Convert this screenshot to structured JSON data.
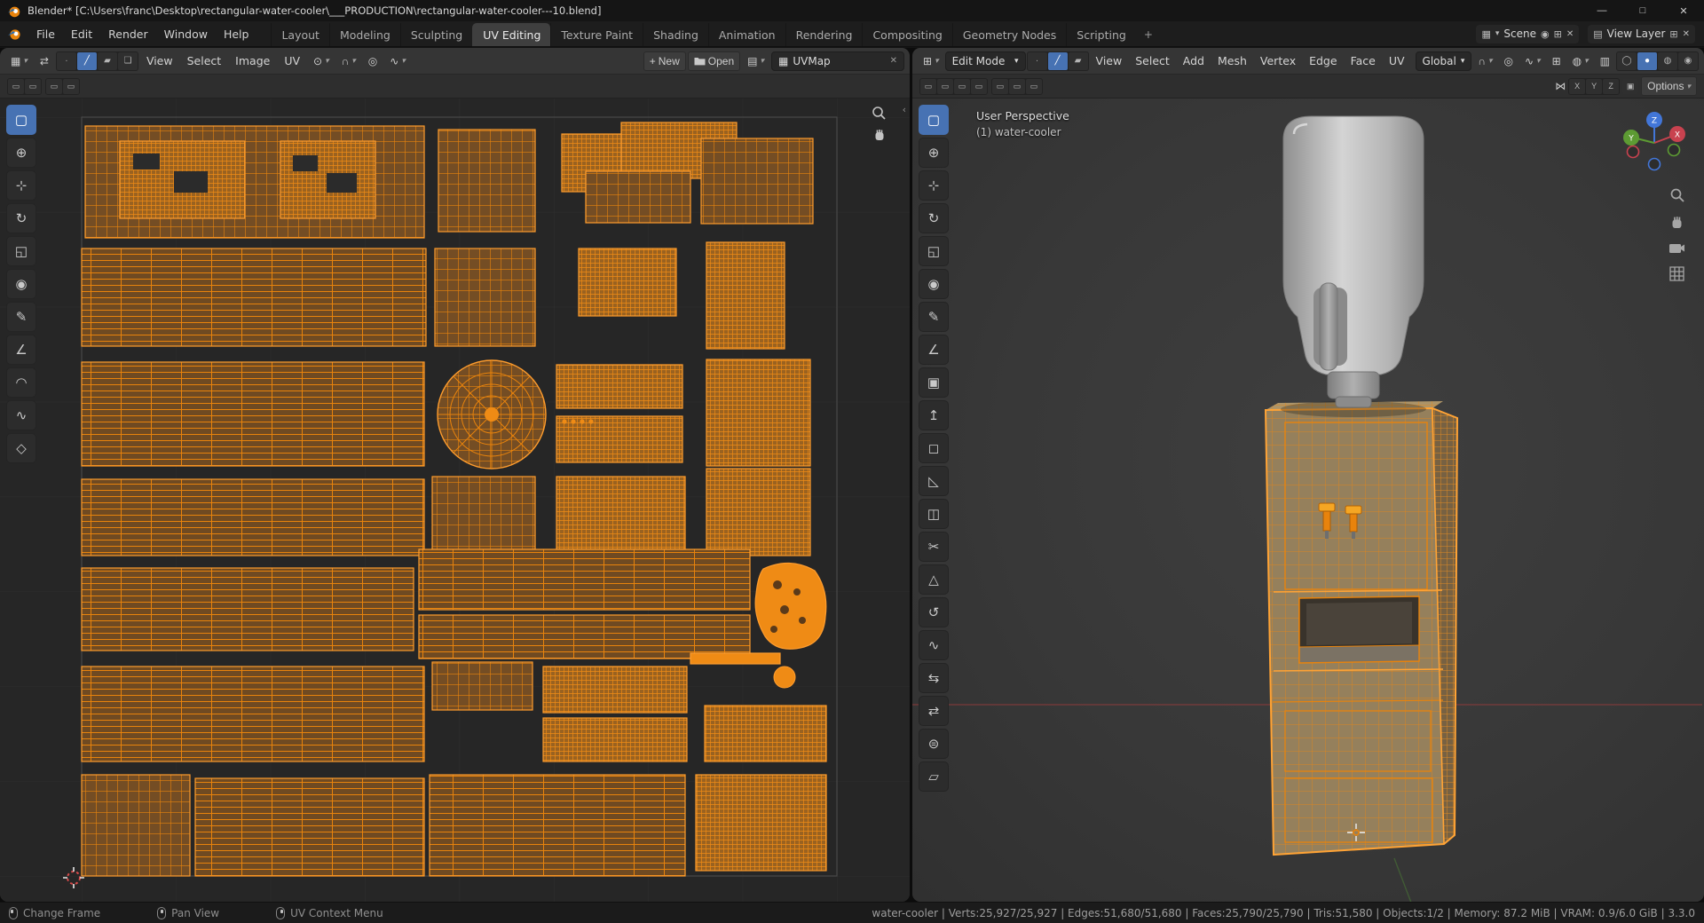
{
  "window": {
    "title": "Blender* [C:\\Users\\franc\\Desktop\\rectangular-water-cooler\\___PRODUCTION\\rectangular-water-cooler---10.blend]",
    "controls": {
      "minimize": "—",
      "maximize": "□",
      "close": "✕"
    }
  },
  "topbar": {
    "menus": [
      "File",
      "Edit",
      "Render",
      "Window",
      "Help"
    ],
    "workspaces": [
      "Layout",
      "Modeling",
      "Sculpting",
      "UV Editing",
      "Texture Paint",
      "Shading",
      "Animation",
      "Rendering",
      "Compositing",
      "Geometry Nodes",
      "Scripting"
    ],
    "add_tab": "+",
    "scene_label": "Scene",
    "view_layer_label": "View Layer"
  },
  "icons": {
    "chevron": "▾",
    "sync": "⇄",
    "magnet": "∩",
    "pivot": "⊙",
    "proportional": "◎",
    "falloff": "∿",
    "editor_uv": "▦",
    "editor_3d": "⊞",
    "image_browse": "▤",
    "scene": "▦",
    "view_layer": "▤",
    "pin": "◉",
    "copy": "⊞",
    "close_x": "✕",
    "plus": "+",
    "mirror": "⋈",
    "snap_target": "▣",
    "gizmo_toggle": "⊞",
    "overlays": "◍",
    "xray": "▥",
    "mode_vertex": "∙",
    "mode_edge": "╱",
    "mode_face": "▰",
    "mode_island": "❏",
    "shade_wire": "◯",
    "shade_solid": "●",
    "shade_material": "◍",
    "shade_render": "◉",
    "toggle": "▭",
    "collapse": "‹"
  },
  "uv_editor": {
    "menus": [
      "View",
      "Select",
      "Image",
      "UV"
    ],
    "new_button": "New",
    "open_button": "Open",
    "uv_map_name": "UVMap",
    "tools": [
      {
        "name": "select-box",
        "glyph": "▢"
      },
      {
        "name": "cursor",
        "glyph": "⊕"
      },
      {
        "name": "move",
        "glyph": "⊹"
      },
      {
        "name": "rotate",
        "glyph": "↻"
      },
      {
        "name": "scale",
        "glyph": "◱"
      },
      {
        "name": "transform",
        "glyph": "◉"
      },
      {
        "name": "annotate",
        "glyph": "✎"
      },
      {
        "name": "measure",
        "glyph": "∠"
      },
      {
        "name": "grab",
        "glyph": "◠"
      },
      {
        "name": "relax",
        "glyph": "∿"
      },
      {
        "name": "pinch",
        "glyph": "◇"
      }
    ]
  },
  "viewport": {
    "mode_selector": "Edit Mode",
    "menus": [
      "View",
      "Select",
      "Add",
      "Mesh",
      "Vertex",
      "Edge",
      "Face",
      "UV"
    ],
    "orientation": "Global",
    "options_label": "Options",
    "mirror_axes": [
      "X",
      "Y",
      "Z"
    ],
    "overlay": {
      "perspective": "User Perspective",
      "object": "(1) water-cooler"
    },
    "gizmo": {
      "x": "X",
      "y": "Y",
      "z": "Z"
    },
    "tools": [
      {
        "name": "select-box",
        "glyph": "▢"
      },
      {
        "name": "cursor",
        "glyph": "⊕"
      },
      {
        "name": "move",
        "glyph": "⊹"
      },
      {
        "name": "rotate",
        "glyph": "↻"
      },
      {
        "name": "scale",
        "glyph": "◱"
      },
      {
        "name": "transform",
        "glyph": "◉"
      },
      {
        "name": "annotate",
        "glyph": "✎"
      },
      {
        "name": "measure",
        "glyph": "∠"
      },
      {
        "name": "add-cube",
        "glyph": "▣"
      },
      {
        "name": "extrude-region",
        "glyph": "↥"
      },
      {
        "name": "inset-faces",
        "glyph": "◻"
      },
      {
        "name": "bevel",
        "glyph": "◺"
      },
      {
        "name": "loop-cut",
        "glyph": "◫"
      },
      {
        "name": "knife",
        "glyph": "✂"
      },
      {
        "name": "poly-build",
        "glyph": "△"
      },
      {
        "name": "spin",
        "glyph": "↺"
      },
      {
        "name": "smooth",
        "glyph": "∿"
      },
      {
        "name": "edge-slide",
        "glyph": "⇆"
      },
      {
        "name": "vertex-slide",
        "glyph": "⇄"
      },
      {
        "name": "shrink-fatten",
        "glyph": "⊜"
      },
      {
        "name": "shear",
        "glyph": "▱"
      }
    ]
  },
  "status_bar": {
    "hints": [
      {
        "label": "Change Frame"
      },
      {
        "label": "Pan View"
      },
      {
        "label": "UV Context Menu"
      }
    ],
    "stats_text": "water-cooler | Verts:25,927/25,927 | Edges:51,680/51,680 | Faces:25,790/25,790 | Tris:51,580 | Objects:1/2 | Memory: 87.2 MiB | VRAM: 0.9/6.0 GiB | 3.3.0"
  }
}
